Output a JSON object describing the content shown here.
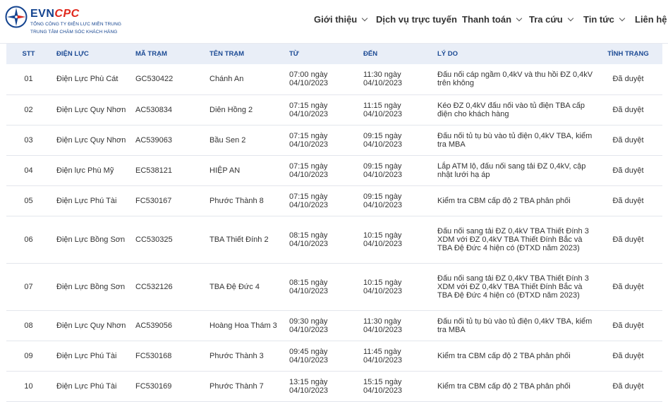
{
  "brand": {
    "name_part1": "EVN",
    "name_part2": "CPC",
    "subtitle1": "TỔNG CÔNG TY ĐIỆN LỰC MIỀN TRUNG",
    "subtitle2": "TRUNG TÂM CHĂM SÓC KHÁCH HÀNG",
    "colors": {
      "blue": "#13438f",
      "red": "#e0271c"
    }
  },
  "nav": {
    "items": [
      {
        "label": "Giới thiệu",
        "has_dropdown": true
      },
      {
        "label": "Dịch vụ trực tuyến",
        "has_dropdown": false
      },
      {
        "label": "Thanh toán",
        "has_dropdown": true
      },
      {
        "label": "Tra cứu",
        "has_dropdown": true
      },
      {
        "label": "Tin tức",
        "has_dropdown": true
      },
      {
        "label": "Liên hệ",
        "has_dropdown": false
      }
    ]
  },
  "table": {
    "headers": [
      "STT",
      "ĐIỆN LỰC",
      "MÃ TRẠM",
      "TÊN TRẠM",
      "TỪ",
      "ĐẾN",
      "LÝ DO",
      "TÌNH TRẠNG"
    ],
    "rows": [
      {
        "stt": "01",
        "dien_luc": "Điện Lực Phù Cát",
        "ma_tram": "GC530422",
        "ten_tram": "Chánh An",
        "tu": "07:00 ngày 04/10/2023",
        "den": "11:30 ngày 04/10/2023",
        "ly_do": "Đấu nối cáp ngầm 0,4kV và thu hồi ĐZ 0,4kV trên không",
        "tinh_trang": "Đã duyệt"
      },
      {
        "stt": "02",
        "dien_luc": "Điện Lực Quy Nhơn",
        "ma_tram": "AC530834",
        "ten_tram": "Diên Hồng 2",
        "tu": "07:15 ngày 04/10/2023",
        "den": "11:15 ngày 04/10/2023",
        "ly_do": "Kéo ĐZ 0,4kV đấu nối vào tủ điện TBA cấp điện cho khách hàng",
        "tinh_trang": "Đã duyệt"
      },
      {
        "stt": "03",
        "dien_luc": "Điện Lực Quy Nhơn",
        "ma_tram": "AC539063",
        "ten_tram": "Bầu Sen 2",
        "tu": "07:15 ngày 04/10/2023",
        "den": "09:15 ngày 04/10/2023",
        "ly_do": "Đấu nối tủ tụ bù vào tủ điện 0,4kV TBA, kiểm tra MBA",
        "tinh_trang": "Đã duyệt"
      },
      {
        "stt": "04",
        "dien_luc": "Điện lực Phù Mỹ",
        "ma_tram": "EC538121",
        "ten_tram": "HIỆP AN",
        "tu": "07:15 ngày 04/10/2023",
        "den": "09:15 ngày 04/10/2023",
        "ly_do": "Lắp ATM lộ, đấu nối sang tải ĐZ 0,4kV, cập nhật lưới hạ áp",
        "tinh_trang": "Đã duyệt"
      },
      {
        "stt": "05",
        "dien_luc": "Điện Lực Phú Tài",
        "ma_tram": "FC530167",
        "ten_tram": "Phước Thành 8",
        "tu": "07:15 ngày 04/10/2023",
        "den": "09:15 ngày 04/10/2023",
        "ly_do": "Kiểm tra CBM cấp độ 2 TBA phân phối",
        "tinh_trang": "Đã duyệt"
      },
      {
        "stt": "06",
        "dien_luc": "Điện Lực Bồng Sơn",
        "ma_tram": "CC530325",
        "ten_tram": "TBA Thiết Đính 2",
        "tu": "08:15 ngày 04/10/2023",
        "den": "10:15 ngày 04/10/2023",
        "ly_do": "Đấu nối sang tải ĐZ 0,4kV TBA Thiết Đính 3 XDM với ĐZ 0,4kV TBA Thiết Đính Bắc và TBA Đệ Đức 4 hiện có (ĐTXD năm 2023)",
        "tinh_trang": "Đã duyệt"
      },
      {
        "stt": "07",
        "dien_luc": "Điện Lực Bồng Sơn",
        "ma_tram": "CC532126",
        "ten_tram": "TBA Đệ Đức 4",
        "tu": "08:15 ngày 04/10/2023",
        "den": "10:15 ngày 04/10/2023",
        "ly_do": "Đấu nối sang tải ĐZ 0,4kV TBA Thiết Đính 3 XDM với ĐZ 0,4kV TBA Thiết Đính Bắc và TBA Đệ Đức 4 hiện có (ĐTXD năm 2023)",
        "tinh_trang": "Đã duyệt"
      },
      {
        "stt": "08",
        "dien_luc": "Điện Lực Quy Nhơn",
        "ma_tram": "AC539056",
        "ten_tram": "Hoàng Hoa Thám 3",
        "tu": "09:30 ngày 04/10/2023",
        "den": "11:30 ngày 04/10/2023",
        "ly_do": "Đấu nối tủ tụ bù vào tủ điện 0,4kV TBA, kiểm tra MBA",
        "tinh_trang": "Đã duyệt"
      },
      {
        "stt": "09",
        "dien_luc": "Điện Lực Phú Tài",
        "ma_tram": "FC530168",
        "ten_tram": "Phước Thành 3",
        "tu": "09:45 ngày 04/10/2023",
        "den": "11:45 ngày 04/10/2023",
        "ly_do": "Kiểm tra CBM cấp độ 2 TBA phân phối",
        "tinh_trang": "Đã duyệt"
      },
      {
        "stt": "10",
        "dien_luc": "Điện Lực Phú Tài",
        "ma_tram": "FC530169",
        "ten_tram": "Phước Thành 7",
        "tu": "13:15 ngày 04/10/2023",
        "den": "15:15 ngày 04/10/2023",
        "ly_do": "Kiểm tra CBM cấp độ 2 TBA phân phối",
        "tinh_trang": "Đã duyệt"
      }
    ]
  }
}
